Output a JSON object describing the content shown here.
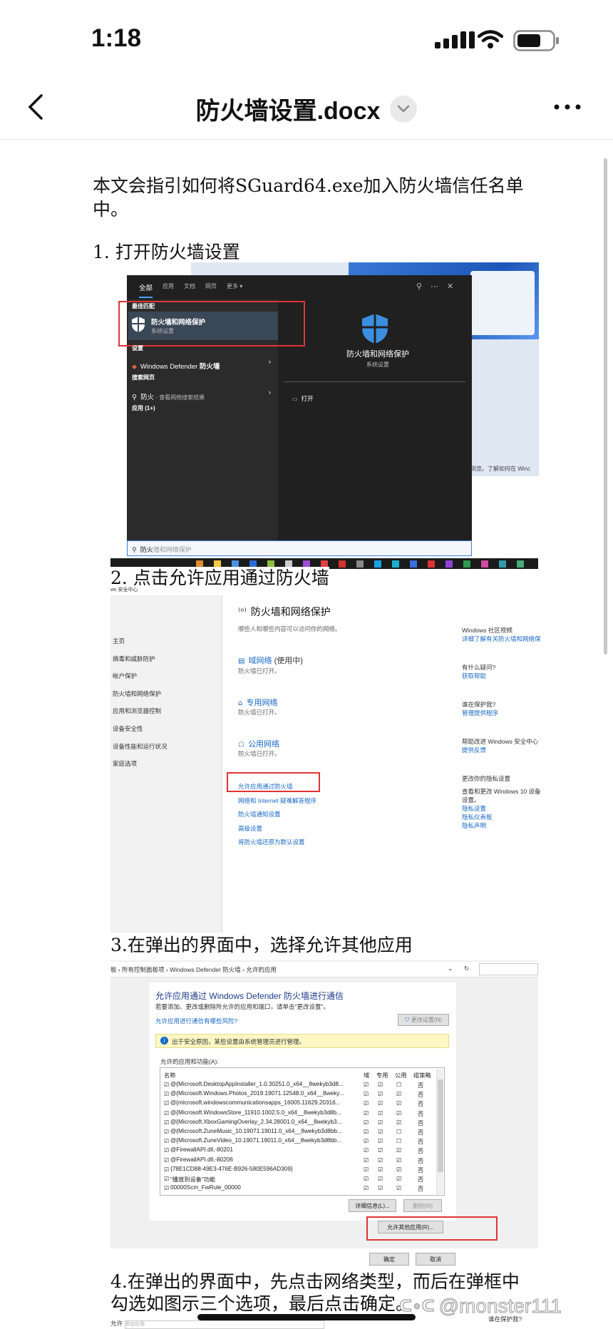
{
  "status_bar": {
    "time": "1:18"
  },
  "header": {
    "title": "防火墙设置.docx",
    "back_icon": "chevron-left-icon",
    "dropdown_icon": "chevron-down-icon",
    "more_icon": "more-horizontal-icon"
  },
  "document": {
    "intro": "本文会指引如何将SGuard64.exe加入防火墙信任名单中。",
    "step1": "1. 打开防火墙设置",
    "step2": "2. 点击允许应用通过防火墙",
    "step3": "3.在弹出的界面中，选择允许其他应用",
    "step4": "4.在弹出的界面中，先点击网络类型，而后在弹框中勾选如图示三个选项，最后点击确定。"
  },
  "screenshot1": {
    "tabs": [
      "全部",
      "应用",
      "文档",
      "网页",
      "更多 ▾"
    ],
    "best_match": "最佳匹配",
    "item_title": "防火墙和网络保护",
    "item_sub": "系统设置",
    "settings": "设置",
    "wdf_prefix": "Windows Defender ",
    "wdf_bold": "防火墙",
    "search_web": "搜索网页",
    "search_query": "防火",
    "search_hint": " - 查看网络搜索结果",
    "apps": "应用 (1+)",
    "right_title": "防火墙和网络保护",
    "right_sub": "系统设置",
    "open": "打开",
    "searchbox_typed": "防火",
    "searchbox_hint": "墙和网络保护",
    "behind_text": "浏览。了解如何在 Winc"
  },
  "screenshot2": {
    "top_fragment": "ws 安全中心",
    "sidebar": [
      "主页",
      "病毒和威胁防护",
      "帐户保护",
      "防火墙和网络保护",
      "应用和浏览器控制",
      "设备安全性",
      "设备性能和运行状况",
      "家庭选项"
    ],
    "title": "防火墙和网络保护",
    "subtitle": "哪些人和哪些内容可以访问你的网络。",
    "networks": [
      {
        "name": "域网络",
        "extra": " (使用中)",
        "status": "防火墙已打开。"
      },
      {
        "name": "专用网络",
        "extra": "",
        "status": "防火墙已打开。"
      },
      {
        "name": "公用网络",
        "extra": "",
        "status": "防火墙已打开。"
      }
    ],
    "links": [
      "允许应用通过防火墙",
      "网络和 Internet 疑难解答程序",
      "防火墙通知设置",
      "高级设置",
      "将防火墙还原为默认设置"
    ],
    "right": [
      {
        "head": "Windows 社区视频",
        "link": "详细了解有关防火墙和网络保护的"
      },
      {
        "head": "有什么疑问?",
        "link": "获取帮助"
      },
      {
        "head": "谁在保护我?",
        "link": "管理提供程序"
      },
      {
        "head": "帮助改进 Windows 安全中心",
        "link": "提供反馈"
      }
    ],
    "privacy_head": "更改你的隐私设置",
    "privacy_text1": "查看和更改 Windows 10 设备",
    "privacy_text2": "设置。",
    "privacy_links": [
      "隐私设置",
      "隐私仪表板",
      "隐私声明"
    ]
  },
  "screenshot3": {
    "breadcrumb": "板 › 所有控制面板项 › Windows Defender 防火墙 › 允许的应用",
    "title": "允许应用通过 Windows Defender 防火墙进行通信",
    "desc": "若要添加、更改或删除所允许的应用和端口，请单击\"更改设置\"。",
    "risk_link": "允许应用进行通信有哪些风险?",
    "change_settings": "更改设置(N)",
    "notice": "出于安全原因，某些设置由系统管理员进行管理。",
    "allowed_label": "允许的应用和功能(A):",
    "columns": [
      "名称",
      "域",
      "专用",
      "公用",
      "组策略"
    ],
    "rows": [
      {
        "name": "@{Microsoft.DesktopAppInstaller_1.0.30251.0_x64__8wekyb3d8...",
        "d": "☑",
        "p": "☑",
        "u": "☐",
        "g": "否"
      },
      {
        "name": "@{Microsoft.Windows.Photos_2019.19071.12548.0_x64__8weky...",
        "d": "☑",
        "p": "☑",
        "u": "☑",
        "g": "否"
      },
      {
        "name": "@{microsoft.windowscommunicationsapps_16005.11629.20316...",
        "d": "☑",
        "p": "☑",
        "u": "☑",
        "g": "否"
      },
      {
        "name": "@{Microsoft.WindowsStore_11910.1002.5.0_x64__8wekyb3d8b...",
        "d": "☑",
        "p": "☑",
        "u": "☑",
        "g": "否"
      },
      {
        "name": "@{Microsoft.XboxGamingOverlay_2.34.28001.0_x64__8wekyb3...",
        "d": "☑",
        "p": "☑",
        "u": "☑",
        "g": "否"
      },
      {
        "name": "@{Microsoft.ZuneMusic_10.19071.19011.0_x64__8wekyb3d8bb...",
        "d": "☑",
        "p": "☑",
        "u": "☐",
        "g": "否"
      },
      {
        "name": "@{Microsoft.ZuneVideo_10.19071.19011.0_x64__8wekyb3d8bb...",
        "d": "☑",
        "p": "☑",
        "u": "☐",
        "g": "否"
      },
      {
        "name": "@FirewallAPI.dll,-80201",
        "d": "☑",
        "p": "☑",
        "u": "☑",
        "g": "否"
      },
      {
        "name": "@FirewallAPI.dll,-80206",
        "d": "☑",
        "p": "☑",
        "u": "☑",
        "g": "否"
      },
      {
        "name": "{78E1CD88-49E3-476E-B926-580E596AD309}",
        "d": "☑",
        "p": "☑",
        "u": "☑",
        "g": "否"
      },
      {
        "name": "\"播放到设备\"功能",
        "d": "☑",
        "p": "☑",
        "u": "☑",
        "g": "否"
      },
      {
        "name": "00000Scm_FwRule_00000",
        "d": "☑",
        "p": "☑",
        "u": "☑",
        "g": "否"
      }
    ],
    "details": "详细信息(L)...",
    "remove": "删除(M)",
    "allow_other": "允许其他应用(R)...",
    "ok": "确定",
    "cancel": "取消"
  },
  "footer": {
    "peek_left": "允许",
    "peek_hint": "添加应用",
    "peek_right": "谁在保护我?",
    "watermark": "@monster111"
  },
  "colors": {
    "accent_red": "#e03434",
    "link_blue": "#1767c6",
    "dark_bg": "#202020"
  }
}
